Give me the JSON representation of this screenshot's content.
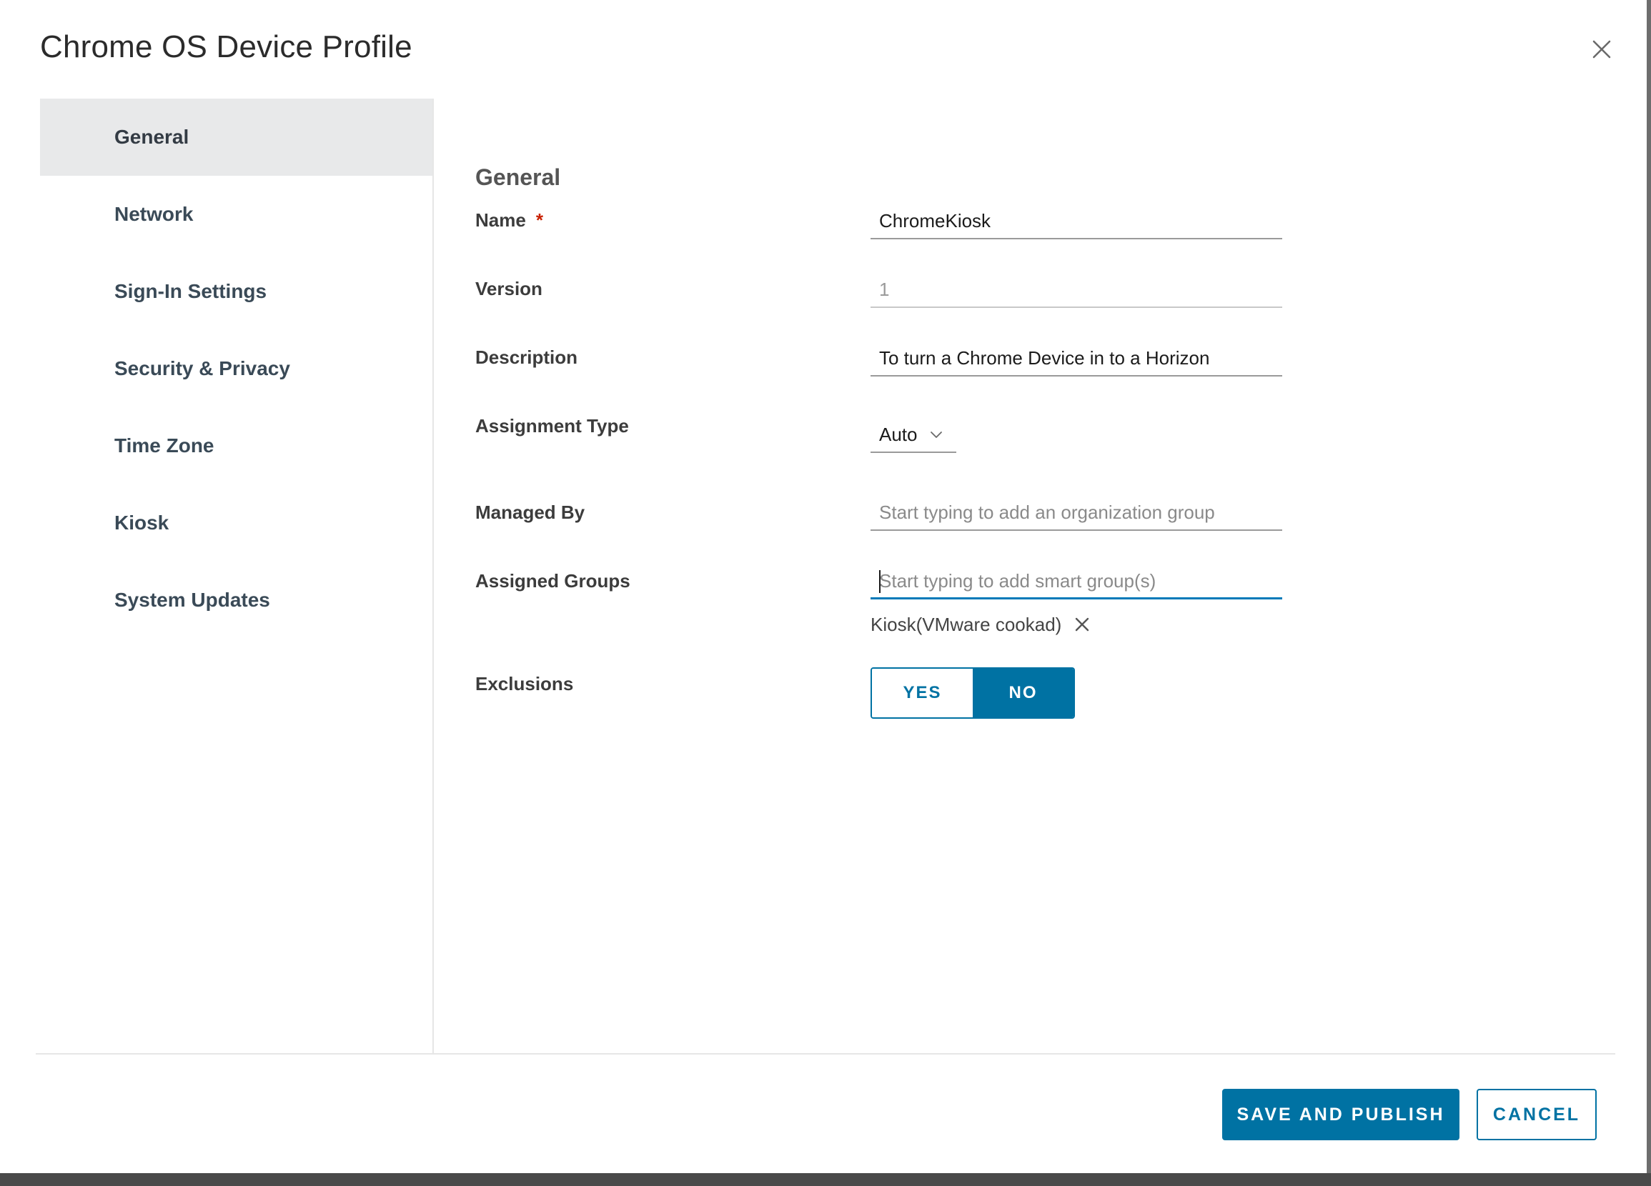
{
  "dialog": {
    "title": "Chrome OS Device Profile",
    "close_icon": "close-icon"
  },
  "sidebar": {
    "items": [
      {
        "label": "General",
        "active": true
      },
      {
        "label": "Network",
        "active": false
      },
      {
        "label": "Sign-In Settings",
        "active": false
      },
      {
        "label": "Security & Privacy",
        "active": false
      },
      {
        "label": "Time Zone",
        "active": false
      },
      {
        "label": "Kiosk",
        "active": false
      },
      {
        "label": "System Updates",
        "active": false
      }
    ]
  },
  "form": {
    "section_title": "General",
    "name": {
      "label": "Name",
      "required_marker": "*",
      "value": "ChromeKiosk"
    },
    "version": {
      "label": "Version",
      "value": "1"
    },
    "description": {
      "label": "Description",
      "value": "To turn a Chrome Device in to a Horizon"
    },
    "assignment_type": {
      "label": "Assignment Type",
      "value": "Auto",
      "icon": "chevron-down-icon"
    },
    "managed_by": {
      "label": "Managed By",
      "placeholder": "Start typing to add an organization group"
    },
    "assigned_groups": {
      "label": "Assigned Groups",
      "placeholder": "Start typing to add smart group(s)",
      "chips": [
        {
          "label": "Kiosk(VMware cookad)",
          "remove_icon": "close-icon"
        }
      ]
    },
    "exclusions": {
      "label": "Exclusions",
      "yes_label": "YES",
      "no_label": "NO",
      "selected": "NO"
    }
  },
  "footer": {
    "primary_label": "SAVE AND PUBLISH",
    "cancel_label": "CANCEL"
  },
  "colors": {
    "accent": "#0072a3",
    "focus": "#0079b8",
    "required": "#c92100",
    "active_nav_bg": "#e8e9ea"
  }
}
